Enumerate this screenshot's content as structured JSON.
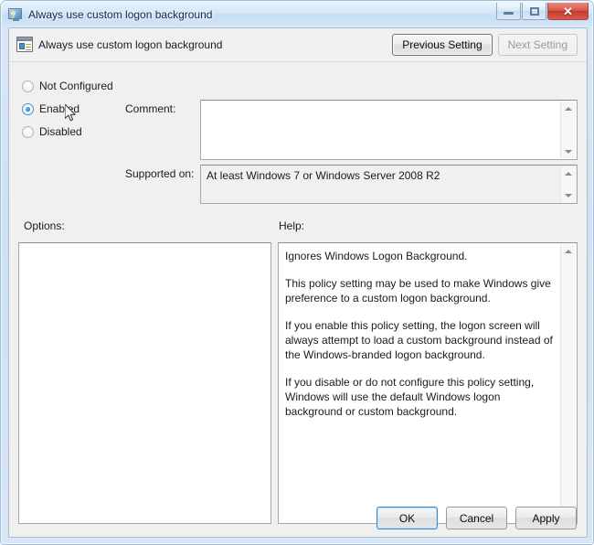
{
  "window": {
    "title": "Always use custom logon background",
    "title_icon": "computer-user-icon",
    "controls": {
      "minimize": "minimize-icon",
      "maximize": "restore-icon",
      "close": "✕"
    }
  },
  "header": {
    "icon": "policy-setting-icon",
    "policy_title": "Always use custom logon background",
    "previous_setting_label": "Previous Setting",
    "next_setting_label": "Next Setting",
    "next_setting_disabled": true
  },
  "state_options": {
    "items": [
      {
        "label": "Not Configured",
        "checked": false
      },
      {
        "label": "Enabled",
        "checked": true
      },
      {
        "label": "Disabled",
        "checked": false
      }
    ]
  },
  "comment": {
    "label": "Comment:",
    "value": "",
    "placeholder": ""
  },
  "supported_on": {
    "label": "Supported on:",
    "value": "At least Windows 7 or Windows Server 2008 R2"
  },
  "options_panel": {
    "label": "Options:",
    "value": ""
  },
  "help_panel": {
    "label": "Help:",
    "paragraphs": [
      "Ignores Windows Logon Background.",
      "This policy setting may be used to make Windows give preference to a custom logon background.",
      "If you enable this policy setting, the logon screen will always attempt to load a custom background instead of the Windows-branded logon background.",
      "If you disable or do not configure this policy setting, Windows will use the default Windows logon background or custom background."
    ]
  },
  "footer": {
    "ok_label": "OK",
    "cancel_label": "Cancel",
    "apply_label": "Apply"
  },
  "colors": {
    "accent": "#2a8ad4",
    "titlebar": "#d5e7f8",
    "close_button": "#c3392b",
    "dialog_background": "#f0f0f0",
    "radio_dot": "#1d74bb"
  }
}
